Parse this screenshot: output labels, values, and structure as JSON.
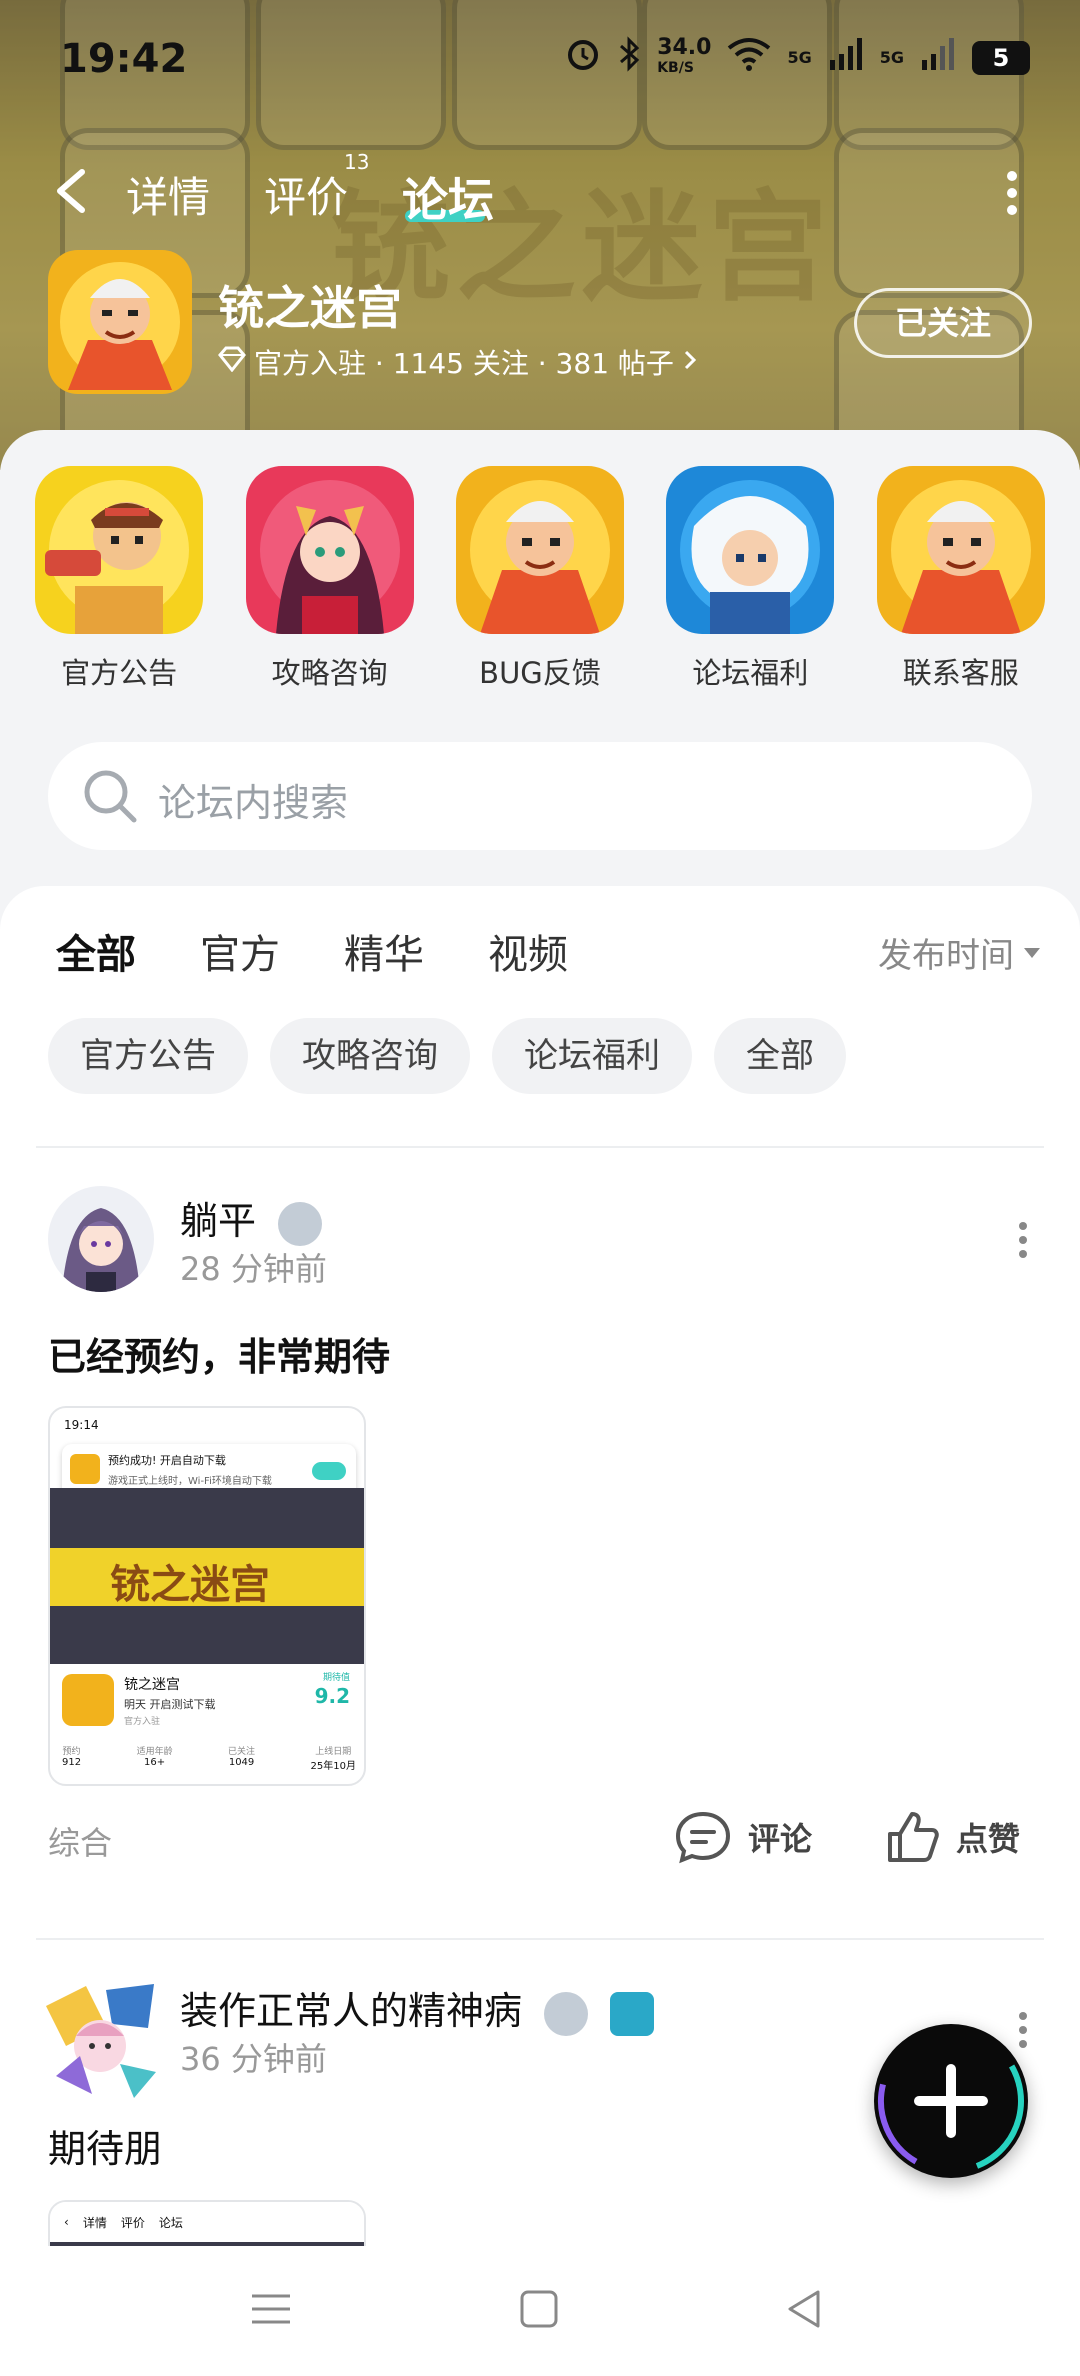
{
  "status_bar": {
    "time": "19:42",
    "net_speed": "34.0",
    "net_unit": "KB/S",
    "signal1": "5G",
    "signal2": "5G",
    "battery": "5"
  },
  "nav": {
    "tabs": [
      {
        "label": "详情",
        "active": false
      },
      {
        "label": "评价",
        "active": false,
        "badge": "13"
      },
      {
        "label": "论坛",
        "active": true
      }
    ]
  },
  "game": {
    "name": "铳之迷宫",
    "meta": "官方入驻 · 1145 关注 · 381 帖子",
    "follow_label": "已关注",
    "banner_title": "铳之迷宫"
  },
  "shortcuts": [
    {
      "label": "官方公告"
    },
    {
      "label": "攻略咨询"
    },
    {
      "label": "BUG反馈"
    },
    {
      "label": "论坛福利"
    },
    {
      "label": "联系客服"
    }
  ],
  "search": {
    "placeholder": "论坛内搜索"
  },
  "filter_tabs": [
    {
      "label": "全部",
      "active": true
    },
    {
      "label": "官方",
      "active": false
    },
    {
      "label": "精华",
      "active": false
    },
    {
      "label": "视频",
      "active": false
    }
  ],
  "sort_label": "发布时间",
  "chips": [
    "官方公告",
    "攻略咨询",
    "论坛福利",
    "全部"
  ],
  "posts": [
    {
      "username": "躺平",
      "time": "28 分钟前",
      "title": "已经预约，非常期待",
      "category": "综合",
      "comment_label": "评论",
      "like_label": "点赞",
      "thumb": {
        "time": "19:14",
        "toast_title": "预约成功! 开启自动下载",
        "toast_sub": "游戏正式上线时，Wi-Fi环境自动下载",
        "game_name": "铳之迷宫",
        "game_sub": "明天 开启测试下载",
        "official": "官方入驻",
        "score_label": "期待值",
        "score": "9.2",
        "stats": [
          {
            "k": "预约",
            "v": "912"
          },
          {
            "k": "适用年龄",
            "v": "16+"
          },
          {
            "k": "已关注",
            "v": "1049"
          },
          {
            "k": "上线日期",
            "v": "25年10月"
          }
        ]
      }
    },
    {
      "username": "装作正常人的精神病",
      "time": "36 分钟前",
      "title": "期待朋",
      "thumb_tabs": [
        "详情",
        "评价",
        "论坛"
      ]
    }
  ],
  "colors": {
    "accent": "#3fd1c4",
    "banner": "#a99a4a"
  }
}
